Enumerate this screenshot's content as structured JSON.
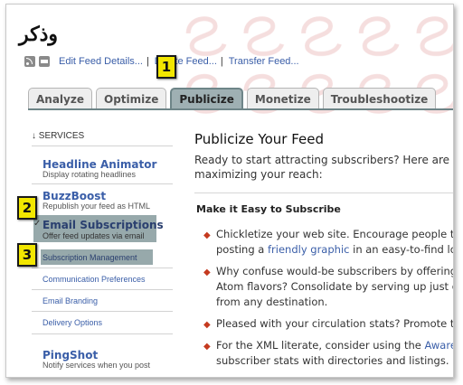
{
  "header": {
    "feed_title": "وذكر",
    "links": {
      "edit_feed_details": "Edit Feed Details...",
      "delete_feed": "Delete Feed...",
      "transfer_feed": "Transfer Feed...",
      "separator": "|"
    }
  },
  "tabs": [
    "Analyze",
    "Optimize",
    "Publicize",
    "Monetize",
    "Troubleshootize"
  ],
  "active_tab": "Publicize",
  "sidebar": {
    "header": "↓ SERVICES",
    "check": "✓",
    "services": [
      {
        "title": "Headline Animator",
        "description": "Display rotating headlines"
      },
      {
        "title": "BuzzBoost",
        "description": "Republish your feed as HTML"
      },
      {
        "title": "Email Subscriptions",
        "description": "Offer feed updates via email"
      }
    ],
    "email_subitems": [
      "Subscription Management",
      "Communication Preferences",
      "Email Branding",
      "Delivery Options"
    ],
    "pingshot": {
      "title": "PingShot",
      "description": "Notify services when you post"
    }
  },
  "main": {
    "title": "Publicize Your Feed",
    "intro_line1": "Ready to start attracting subscribers? Here are som",
    "intro_line2": "maximizing your reach:",
    "section_header": "Make it Easy to Subscribe",
    "bullets": [
      {
        "l1": "Chickletize your web site. Encourage people to",
        "l2a": "posting a ",
        "l2link": "friendly graphic",
        "l2b": " in an easy-to-find loc"
      },
      {
        "l1": "Why confuse would-be subscribers by offering",
        "l2": "Atom flavors? Consolidate by serving up just on",
        "l3": "from any destination."
      },
      {
        "l1": "Pleased with your circulation stats? Promote the"
      },
      {
        "l1a": "For the XML literate, consider using the ",
        "l1link": "Awaren",
        "l2": "subscriber stats with directories and listings."
      }
    ]
  },
  "callouts": [
    "1",
    "2",
    "3"
  ],
  "icons": [
    "rss-icon",
    "email-icon",
    "bullet-diamond-icon",
    "check-icon"
  ],
  "colors": {
    "link": "#3a5ea8",
    "active_tab": "#9fb0b3",
    "highlight": "#97a9ab",
    "bullet": "#c53a1f",
    "badge": "#f2e600"
  }
}
